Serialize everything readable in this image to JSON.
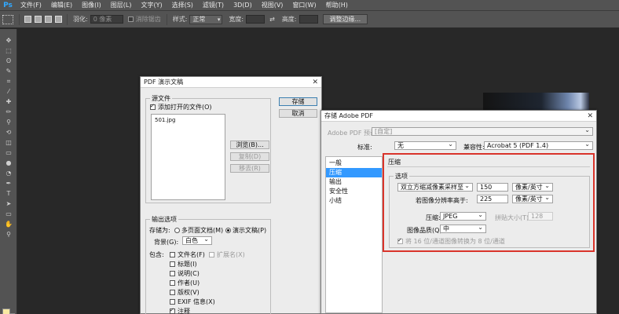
{
  "app": {
    "logo": "Ps",
    "menu": [
      "文件(F)",
      "编辑(E)",
      "图像(I)",
      "图层(L)",
      "文字(Y)",
      "选择(S)",
      "滤镜(T)",
      "3D(D)",
      "视图(V)",
      "窗口(W)",
      "帮助(H)"
    ]
  },
  "options_bar": {
    "feather_label": "羽化:",
    "feather_value": "0 像素",
    "antialias_label": "消除锯齿",
    "style_label": "样式:",
    "style_value": "正常",
    "width_label": "宽度:",
    "height_label": "高度:",
    "refine_edge_button": "调整边缘..."
  },
  "tools": [
    "move-tool",
    "marquee-tool",
    "lasso-tool",
    "quick-select-tool",
    "crop-tool",
    "eyedropper-tool",
    "healing-tool",
    "brush-tool",
    "clone-stamp-tool",
    "history-brush-tool",
    "eraser-tool",
    "gradient-tool",
    "blur-tool",
    "dodge-tool",
    "pen-tool",
    "type-tool",
    "path-select-tool",
    "shape-tool",
    "hand-tool",
    "zoom-tool"
  ],
  "tool_glyphs": [
    "✥",
    "⬚",
    "ʘ",
    "✎",
    "⌗",
    "⁄",
    "✚",
    "✏",
    "⚲",
    "⟲",
    "◫",
    "▭",
    "●",
    "◔",
    "✒",
    "T",
    "➤",
    "▭",
    "✋",
    "⚲"
  ],
  "colors": {
    "foreground": "#f8e9a3",
    "background": "#e5562d",
    "selection_blue": "#3399ff",
    "highlight_red": "#d9342b"
  },
  "pdf_presentation": {
    "title": "PDF 演示文稿",
    "source_files_group": "源文件",
    "add_open_files_label": "添加打开的文件(O)",
    "file_list": [
      "501.jpg"
    ],
    "browse_button": "浏览(B)...",
    "duplicate_button": "复制(D)",
    "remove_button": "移去(R)",
    "save_button": "存储",
    "cancel_button": "取消",
    "output_group": "输出选项",
    "save_as_label": "存储为:",
    "multipage_option": "多页面文档(M)",
    "presentation_option": "演示文稿(P)",
    "background_label": "背景(G):",
    "background_value": "白色",
    "include_label": "包含:",
    "filename_option": "文件名(F)",
    "extension_option": "扩展名(X)",
    "title_option": "标题(I)",
    "description_option": "说明(C)",
    "author_option": "作者(U)",
    "copyright_option": "版权(V)",
    "exif_option": "EXIF 信息(X)",
    "notes_option": "注释"
  },
  "save_adobe_pdf": {
    "title": "存储 Adobe PDF",
    "preset_label": "Adobe PDF 预设:",
    "preset_value": "[自定]",
    "standard_label": "标准:",
    "standard_value": "无",
    "compatibility_label": "兼容性:",
    "compatibility_value": "Acrobat 5 (PDF 1.4)",
    "nav_items": [
      "一般",
      "压缩",
      "输出",
      "安全性",
      "小结"
    ],
    "nav_selected": "压缩",
    "section_title": "压缩",
    "options_group": "选项",
    "downsample_value": "双立方缩减像素采样至",
    "downsample_ppi": "150",
    "downsample_unit": "像素/英寸",
    "above_label": "若图像分辨率高于:",
    "above_ppi": "225",
    "above_unit": "像素/英寸",
    "compression_label": "压缩:",
    "compression_value": "JPEG",
    "tile_size_label": "拼贴大小(T):",
    "tile_size_value": "128",
    "quality_label": "图像品质(Q):",
    "quality_value": "中",
    "convert_bits_label": "将 16 位/通道图像转换为 8 位/通道"
  }
}
